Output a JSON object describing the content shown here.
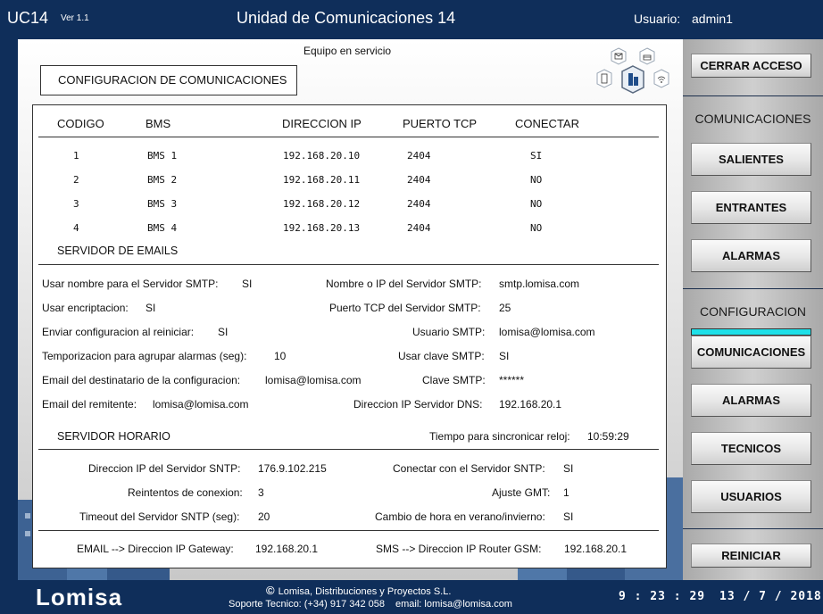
{
  "header": {
    "app_name": "UC14",
    "version": "Ver 1.1",
    "title": "Unidad de Comunicaciones 14",
    "user_label": "Usuario:",
    "user_name": "admin1"
  },
  "main": {
    "status": "Equipo en servicio",
    "section_title": "CONFIGURACION DE COMUNICACIONES"
  },
  "bms_table": {
    "headers": [
      "CODIGO",
      "BMS",
      "DIRECCION IP",
      "PUERTO TCP",
      "CONECTAR"
    ],
    "rows": [
      [
        "1",
        "BMS 1",
        "192.168.20.10",
        "2404",
        "SI"
      ],
      [
        "2",
        "BMS 2",
        "192.168.20.11",
        "2404",
        "NO"
      ],
      [
        "3",
        "BMS 3",
        "192.168.20.12",
        "2404",
        "NO"
      ],
      [
        "4",
        "BMS 4",
        "192.168.20.13",
        "2404",
        "NO"
      ]
    ]
  },
  "email": {
    "section": "SERVIDOR DE EMAILS",
    "left": [
      {
        "label": "Usar nombre para el Servidor SMTP:",
        "value": "SI"
      },
      {
        "label": "Usar encriptacion:",
        "value": "SI"
      },
      {
        "label": "Enviar configuracion al reiniciar:",
        "value": "SI"
      },
      {
        "label": "Temporizacion para agrupar alarmas (seg):",
        "value": "10"
      },
      {
        "label": "Email del destinatario de la configuracion:",
        "value": "lomisa@lomisa.com"
      },
      {
        "label": "Email del remitente:",
        "value": "lomisa@lomisa.com"
      }
    ],
    "right": [
      {
        "label": "Nombre o IP del Servidor SMTP:",
        "value": "smtp.lomisa.com"
      },
      {
        "label": "Puerto TCP del Servidor SMTP:",
        "value": "25"
      },
      {
        "label": "Usuario SMTP:",
        "value": "lomisa@lomisa.com"
      },
      {
        "label": "Usar clave SMTP:",
        "value": "SI"
      },
      {
        "label": "Clave SMTP:",
        "value": "******"
      },
      {
        "label": "Direccion IP Servidor DNS:",
        "value": "192.168.20.1"
      }
    ]
  },
  "time_server": {
    "section": "SERVIDOR HORARIO",
    "sync_label": "Tiempo para sincronicar reloj:",
    "sync_value": "10:59:29",
    "left": [
      {
        "label": "Direccion IP del Servidor SNTP:",
        "value": "176.9.102.215"
      },
      {
        "label": "Reintentos de conexion:",
        "value": "3"
      },
      {
        "label": "Timeout del Servidor SNTP (seg):",
        "value": "20"
      }
    ],
    "right": [
      {
        "label": "Conectar con el Servidor SNTP:",
        "value": "SI"
      },
      {
        "label": "Ajuste GMT:",
        "value": "1"
      },
      {
        "label": "Cambio de hora en verano/invierno:",
        "value": "SI"
      }
    ]
  },
  "gateway": {
    "email_label": "EMAIL -->  Direccion IP Gateway:",
    "email_value": "192.168.20.1",
    "sms_label": "SMS  --> Direccion IP Router GSM:",
    "sms_value": "192.168.20.1"
  },
  "sidebar": {
    "close_access": "CERRAR ACCESO",
    "comms_header": "COMUNICACIONES",
    "outgoing": "SALIENTES",
    "incoming": "ENTRANTES",
    "alarms": "ALARMAS",
    "config_header": "CONFIGURACION",
    "config_comms": "COMUNICACIONES",
    "config_alarms": "ALARMAS",
    "technicians": "TECNICOS",
    "users": "USUARIOS",
    "restart": "REINICIAR"
  },
  "footer": {
    "logo": "Lomisa",
    "copyright": "Lomisa, Distribuciones y Proyectos S.L.",
    "support": "Soporte Tecnico: (+34) 917 342 058",
    "email": "email: lomisa@lomisa.com",
    "time": "9 : 23 : 29",
    "date": "13 /  7  / 2018"
  },
  "colors": {
    "navy": "#0f2e5a",
    "active_indicator": "#1ee0e8"
  },
  "icons": [
    "mail-icon",
    "inbox-icon",
    "tablet-icon",
    "building-icon",
    "wifi-icon"
  ]
}
